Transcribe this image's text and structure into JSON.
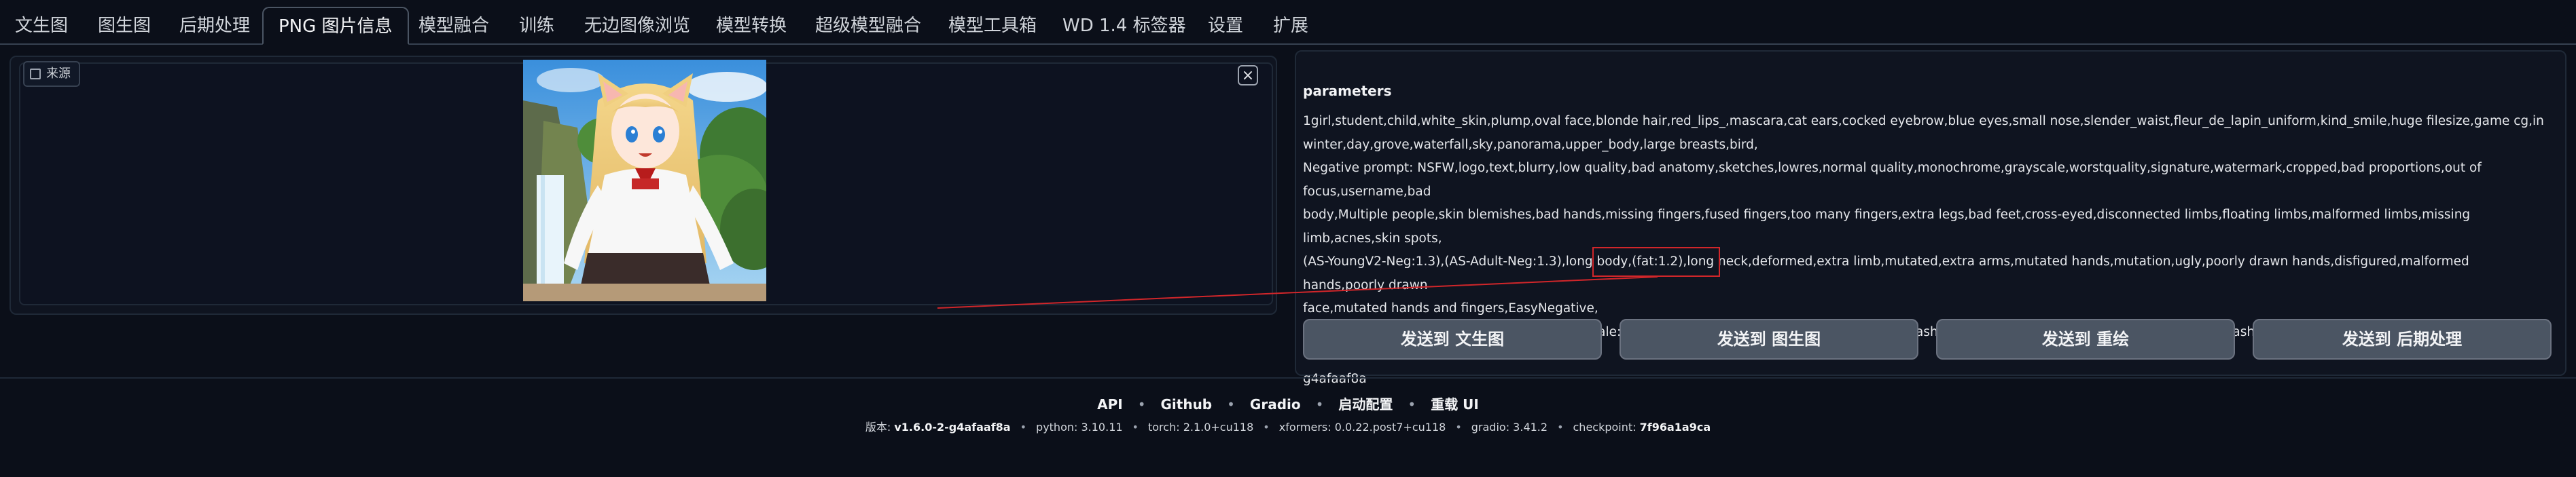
{
  "tabs": [
    {
      "label": "文生图",
      "active": false
    },
    {
      "label": "图生图",
      "active": false
    },
    {
      "label": "后期处理",
      "active": false
    },
    {
      "label": "PNG 图片信息",
      "active": true
    },
    {
      "label": "模型融合",
      "active": false
    },
    {
      "label": "训练",
      "active": false
    },
    {
      "label": "无边图像浏览",
      "active": false
    },
    {
      "label": "模型转换",
      "active": false
    },
    {
      "label": "超级模型融合",
      "active": false
    },
    {
      "label": "模型工具箱",
      "active": false
    },
    {
      "label": "WD 1.4 标签器",
      "active": false
    },
    {
      "label": "设置",
      "active": false
    },
    {
      "label": "扩展",
      "active": false
    }
  ],
  "image_panel": {
    "source_label": "来源",
    "source_icon": "image-icon",
    "close_symbol": "×"
  },
  "params": {
    "title": "parameters",
    "lines": [
      "1girl,student,child,white_skin,plump,oval face,blonde hair,red_lips_,mascara,cat ears,cocked eyebrow,blue eyes,small nose,slender_waist,fleur_de_lapin_uniform,kind_smile,huge filesize,game cg,in",
      "winter,day,grove,waterfall,sky,panorama,upper_body,large breasts,bird,",
      "Negative prompt: NSFW,logo,text,blurry,low quality,bad anatomy,sketches,lowres,normal quality,monochrome,grayscale,worstquality,signature,watermark,cropped,bad proportions,out of focus,username,bad",
      "body,Multiple people,skin blemishes,bad hands,missing fingers,fused fingers,too many fingers,extra legs,bad feet,cross-eyed,disconnected limbs,floating limbs,malformed limbs,missing limb,acnes,skin spots,",
      "(AS-YoungV2-Neg:1.3),(AS-Adult-Neg:1.3),long body,(fat:1.2),long neck,deformed,extra limb,mutated,extra arms,mutated hands,mutation,ugly,poorly drawn hands,disfigured,malformed hands,poorly drawn",
      "face,mutated hands and fingers,EasyNegative,",
      "Steps: 20, Sampler: DPM++ 2M Karras, CFG scale: 7, Seed: 1506488986, Size: 512x512, Model hash: 7f96a1a9ca, Model: anything-v5-PrtRE, VAE hash: f921fb3f29, VAE: animevae.pt, Clip skip: 2, Version: v1.6.0-2-",
      "g4afaaf8a"
    ]
  },
  "buttons": {
    "txt2img": "发送到 文生图",
    "img2img": "发送到 图生图",
    "inpaint": "发送到 重绘",
    "extras": "发送到 后期处理"
  },
  "footer": {
    "links": [
      "API",
      "Github",
      "Gradio",
      "启动配置",
      "重载 UI"
    ],
    "versions": {
      "version_label": "版本:",
      "version_value": "v1.6.0-2-g4afaaf8a",
      "python": "python: 3.10.11",
      "torch": "torch: 2.1.0+cu118",
      "xformers": "xformers: 0.0.22.post7+cu118",
      "gradio": "gradio: 3.41.2",
      "checkpoint_label": "checkpoint:",
      "checkpoint_value": "7f96a1a9ca"
    },
    "separator": "•"
  },
  "colors": {
    "background": "#0b0f19",
    "panel": "#0f1420",
    "button": "#4b5563",
    "annotation_red": "#d1262a"
  }
}
